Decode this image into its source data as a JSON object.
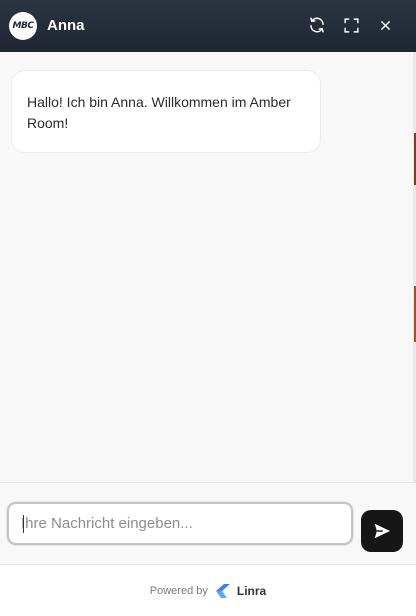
{
  "header": {
    "avatar_text": "MBC",
    "title": "Anna",
    "icons": [
      "refresh-icon",
      "expand-icon",
      "close-icon"
    ]
  },
  "messages": [
    {
      "sender": "bot",
      "text": "Hallo! Ich bin Anna. Willkommen im Amber Room!"
    }
  ],
  "composer": {
    "placeholder": "Ihre Nachricht eingeben...",
    "value": "",
    "send_icon": "send-icon"
  },
  "footer": {
    "powered_label": "Powered by",
    "brand_name": "Linra",
    "brand_icon": "linra-logo-icon"
  },
  "colors": {
    "header": "#252d3a",
    "send_button": "#161616",
    "brand_logo": "#3b82f6"
  }
}
